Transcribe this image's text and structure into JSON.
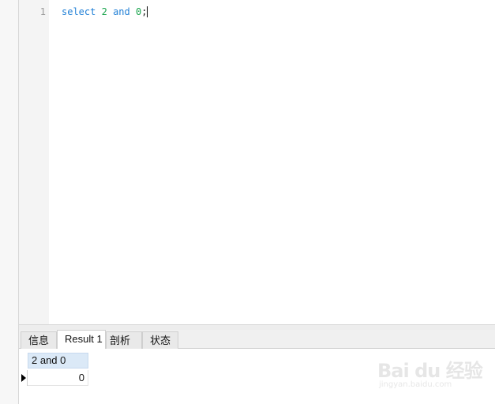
{
  "editor": {
    "line_number": "1",
    "code_tokens": {
      "keyword_select": "select",
      "num_2": "2",
      "keyword_and": "and",
      "num_0": "0",
      "semicolon": ";"
    },
    "colors": {
      "keyword": "#1f7fd6",
      "number": "#16a34a"
    }
  },
  "tabs": [
    {
      "label": "信息"
    },
    {
      "label": "Result 1",
      "active": true
    },
    {
      "label": "剖析"
    },
    {
      "label": "状态"
    }
  ],
  "result": {
    "columns": [
      "2 and 0"
    ],
    "rows": [
      [
        "0"
      ]
    ],
    "header_color": "#dbe9f7"
  },
  "watermark": {
    "logo": "Bai du 经验",
    "url": "jingyan.baidu.com"
  }
}
